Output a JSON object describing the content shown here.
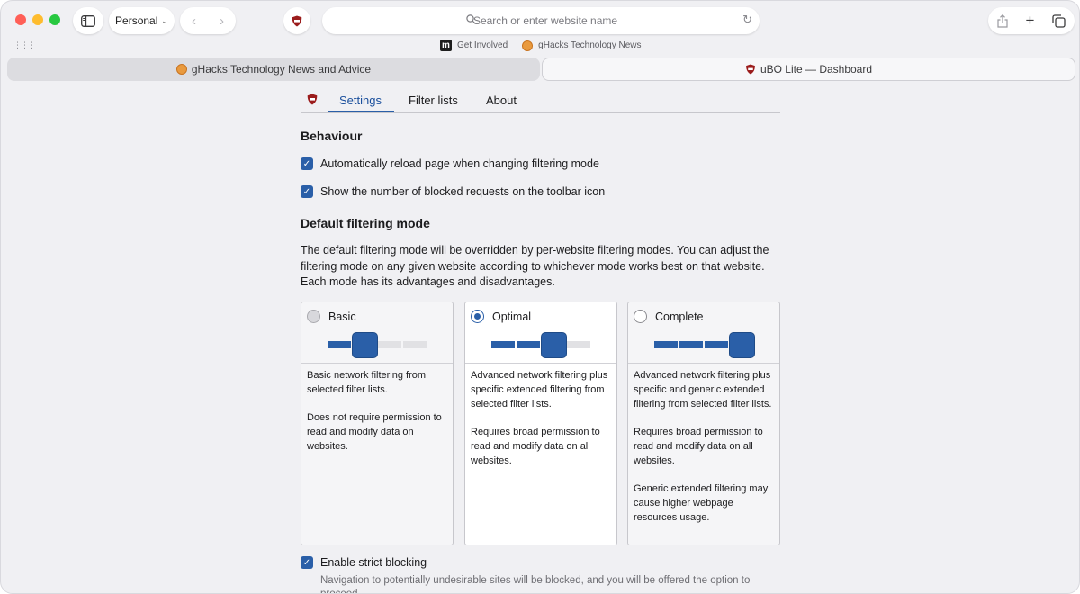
{
  "browser": {
    "profile_label": "Personal",
    "address_placeholder": "Search or enter website name",
    "favorites": [
      {
        "label": "Get Involved",
        "icon": "m-logo-icon"
      },
      {
        "label": "gHacks Technology News",
        "icon": "ghacks-logo-icon"
      }
    ],
    "tabs": [
      {
        "label": "gHacks Technology News and Advice",
        "active": false
      },
      {
        "label": "uBO Lite — Dashboard",
        "active": true
      }
    ],
    "icons": {
      "sidebar": "sidebar-toggle-icon",
      "back": "back-arrow-icon",
      "forward": "forward-arrow-icon",
      "extension": "ublock-shield-icon",
      "search": "search-icon",
      "reload": "reload-icon",
      "share": "share-icon",
      "new_tab": "plus-icon",
      "tab_overview": "tab-overview-icon"
    }
  },
  "dashboard": {
    "nav": {
      "tabs": [
        "Settings",
        "Filter lists",
        "About"
      ],
      "active": "Settings"
    },
    "behaviour": {
      "heading": "Behaviour",
      "options": [
        {
          "label": "Automatically reload page when changing filtering mode",
          "checked": true
        },
        {
          "label": "Show the number of blocked requests on the toolbar icon",
          "checked": true
        }
      ]
    },
    "default_mode": {
      "heading": "Default filtering mode",
      "description": "The default filtering mode will be overridden by per-website filtering modes. You can adjust the filtering mode on any given website according to whichever mode works best on that website. Each mode has its advantages and disadvantages.",
      "modes": [
        {
          "label": "Basic",
          "selected": false,
          "level": 2,
          "paragraphs": [
            "Basic network filtering from selected filter lists.",
            "Does not require permission to read and modify data on websites."
          ]
        },
        {
          "label": "Optimal",
          "selected": true,
          "level": 3,
          "paragraphs": [
            "Advanced network filtering plus specific extended filtering from selected filter lists.",
            "Requires broad permission to read and modify data on all websites."
          ]
        },
        {
          "label": "Complete",
          "selected": false,
          "level": 4,
          "paragraphs": [
            "Advanced network filtering plus specific and generic extended filtering from selected filter lists.",
            "Requires broad permission to read and modify data on all websites.",
            "Generic extended filtering may cause higher webpage resources usage."
          ]
        }
      ]
    },
    "strict_blocking": {
      "label": "Enable strict blocking",
      "checked": true,
      "description": "Navigation to potentially undesirable sites will be blocked, and you will be offered the option to proceed."
    }
  },
  "colors": {
    "accent": "#2a5fa8",
    "shield": "#9b1c1c"
  }
}
